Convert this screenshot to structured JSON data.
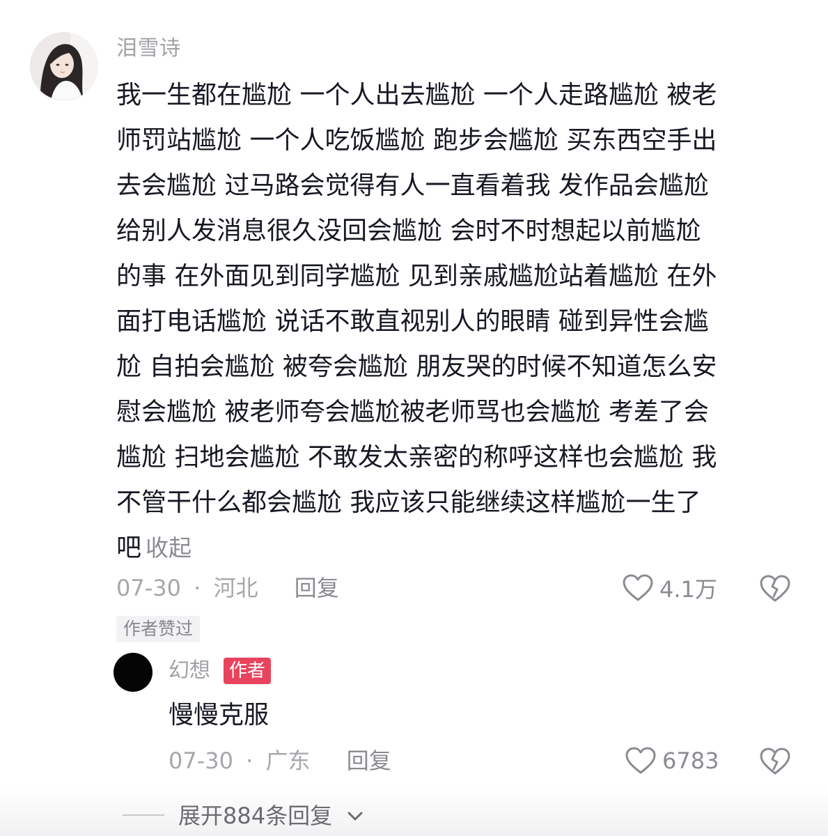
{
  "comment": {
    "username": "泪雪诗",
    "avatar_icon": "user-avatar-photo",
    "lines": [
      "我一生都在尴尬 一个人出去尴尬 一个人走路尴尬 被老",
      "师罚站尴尬 一个人吃饭尴尬 跑步会尴尬 买东西空手出",
      "去会尴尬 过马路会觉得有人一直看着我 发作品会尴尬",
      "给别人发消息很久没回会尴尬 会时不时想起以前尴尬",
      "的事 在外面见到同学尴尬 见到亲戚尴尬站着尴尬 在外",
      "面打电话尴尬 说话不敢直视别人的眼睛 碰到异性会尴",
      "尬 自拍会尴尬 被夸会尴尬 朋友哭的时候不知道怎么安",
      "慰会尴尬 被老师夸会尴尬被老师骂也会尴尬 考差了会",
      "尴尬 扫地会尴尬 不敢发太亲密的称呼这样也会尴尬 我",
      "不管干什么都会尴尬 我应该只能继续这样尴尬一生了"
    ],
    "last_line": "吧",
    "collapse_label": "收起",
    "date": "07-30",
    "separator": "·",
    "location": "河北",
    "reply_label": "回复",
    "like_count": "4.1万",
    "author_liked_badge": "作者赞过"
  },
  "reply": {
    "username": "幻想",
    "author_tag": "作者",
    "text": "慢慢克服",
    "date": "07-30",
    "separator": "·",
    "location": "广东",
    "reply_label": "回复",
    "like_count": "6783"
  },
  "expand": {
    "label": "展开884条回复",
    "icon": "chevron-down-icon"
  },
  "colors": {
    "text_primary": "#161823",
    "text_secondary": "#a1a1a6",
    "author_tag_bg": "#e9425c",
    "badge_bg": "#f2f2f4"
  }
}
